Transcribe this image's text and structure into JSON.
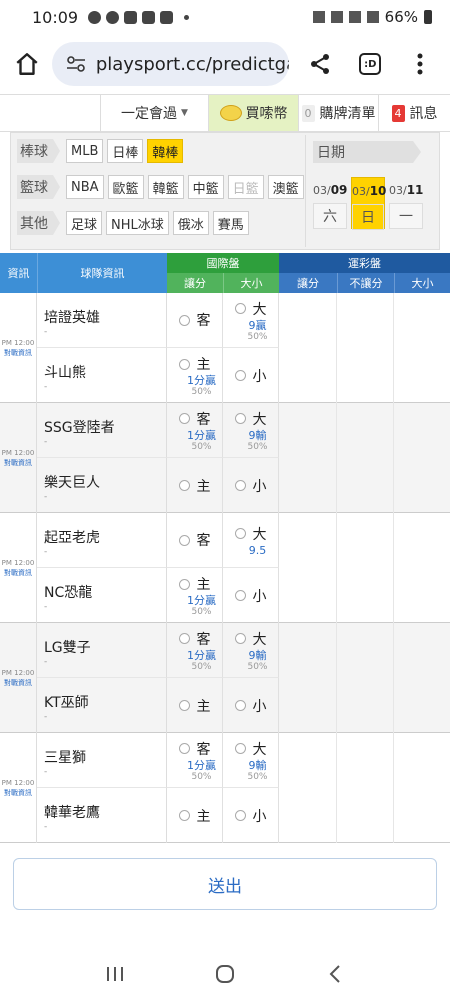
{
  "status": {
    "time": "10:09",
    "battery": "66%"
  },
  "browser": {
    "url": "playsport.cc/predictga"
  },
  "sitenav": {
    "club": "一定會過",
    "coin": "買嗦幣",
    "cart_count": "0",
    "cart": "購牌清單",
    "msg_count": "4",
    "msg": "訊息"
  },
  "filters": {
    "rows": [
      {
        "tag": "棒球",
        "items": [
          {
            "label": "MLB",
            "state": ""
          },
          {
            "label": "日棒",
            "state": ""
          },
          {
            "label": "韓棒",
            "state": "active"
          }
        ]
      },
      {
        "tag": "籃球",
        "items": [
          {
            "label": "NBA",
            "state": ""
          },
          {
            "label": "歐籃",
            "state": ""
          },
          {
            "label": "韓籃",
            "state": ""
          },
          {
            "label": "中籃",
            "state": ""
          },
          {
            "label": "日籃",
            "state": "disabled"
          },
          {
            "label": "澳籃",
            "state": ""
          }
        ]
      },
      {
        "tag": "其他",
        "items": [
          {
            "label": "足球",
            "state": ""
          },
          {
            "label": "NHL冰球",
            "state": ""
          },
          {
            "label": "俄冰",
            "state": ""
          },
          {
            "label": "賽馬",
            "state": ""
          }
        ]
      }
    ],
    "date_label": "日期",
    "dates": [
      {
        "m": "03/",
        "d": "09",
        "w": "六",
        "active": false
      },
      {
        "m": "03/",
        "d": "10",
        "w": "日",
        "active": true
      },
      {
        "m": "03/",
        "d": "11",
        "w": "一",
        "active": false
      }
    ]
  },
  "table_head": {
    "info": "資訊",
    "team": "球隊資訊",
    "intl": "國際盤",
    "lottery": "運彩盤",
    "handicap": "讓分",
    "total": "大小",
    "l_handicap": "讓分",
    "l_nohandicap": "不讓分",
    "l_total": "大小"
  },
  "games": [
    {
      "time": "PM 12:00",
      "link": "對戰資訊",
      "away": {
        "name": "培證英雄",
        "sub": "-"
      },
      "home": {
        "name": "斗山熊",
        "sub": "-"
      },
      "h1": {
        "side": "客",
        "odds": "",
        "pct": ""
      },
      "h2": {
        "side": "主",
        "odds": "1分贏",
        "pct": "50%"
      },
      "t1": {
        "side": "大",
        "odds": "9贏",
        "pct": "50%"
      },
      "t2": {
        "side": "小",
        "odds": "",
        "pct": ""
      }
    },
    {
      "time": "PM 12:00",
      "link": "對戰資訊",
      "away": {
        "name": "SSG登陸者",
        "sub": "-"
      },
      "home": {
        "name": "樂天巨人",
        "sub": "-"
      },
      "h1": {
        "side": "客",
        "odds": "1分贏",
        "pct": "50%"
      },
      "h2": {
        "side": "主",
        "odds": "",
        "pct": ""
      },
      "t1": {
        "side": "大",
        "odds": "9輸",
        "pct": "50%"
      },
      "t2": {
        "side": "小",
        "odds": "",
        "pct": ""
      }
    },
    {
      "time": "PM 12:00",
      "link": "對戰資訊",
      "away": {
        "name": "起亞老虎",
        "sub": "-"
      },
      "home": {
        "name": "NC恐龍",
        "sub": "-"
      },
      "h1": {
        "side": "客",
        "odds": "",
        "pct": ""
      },
      "h2": {
        "side": "主",
        "odds": "1分贏",
        "pct": "50%"
      },
      "t1": {
        "side": "大",
        "odds": "9.5",
        "pct": ""
      },
      "t2": {
        "side": "小",
        "odds": "",
        "pct": ""
      }
    },
    {
      "time": "PM 12:00",
      "link": "對戰資訊",
      "away": {
        "name": "LG雙子",
        "sub": "-"
      },
      "home": {
        "name": "KT巫師",
        "sub": "-"
      },
      "h1": {
        "side": "客",
        "odds": "1分贏",
        "pct": "50%"
      },
      "h2": {
        "side": "主",
        "odds": "",
        "pct": ""
      },
      "t1": {
        "side": "大",
        "odds": "9輸",
        "pct": "50%"
      },
      "t2": {
        "side": "小",
        "odds": "",
        "pct": ""
      }
    },
    {
      "time": "PM 12:00",
      "link": "對戰資訊",
      "away": {
        "name": "三星獅",
        "sub": "-"
      },
      "home": {
        "name": "韓華老鷹",
        "sub": "-"
      },
      "h1": {
        "side": "客",
        "odds": "1分贏",
        "pct": "50%"
      },
      "h2": {
        "side": "主",
        "odds": "",
        "pct": ""
      },
      "t1": {
        "side": "大",
        "odds": "9輸",
        "pct": "50%"
      },
      "t2": {
        "side": "小",
        "odds": "",
        "pct": ""
      }
    }
  ],
  "submit": "送出"
}
